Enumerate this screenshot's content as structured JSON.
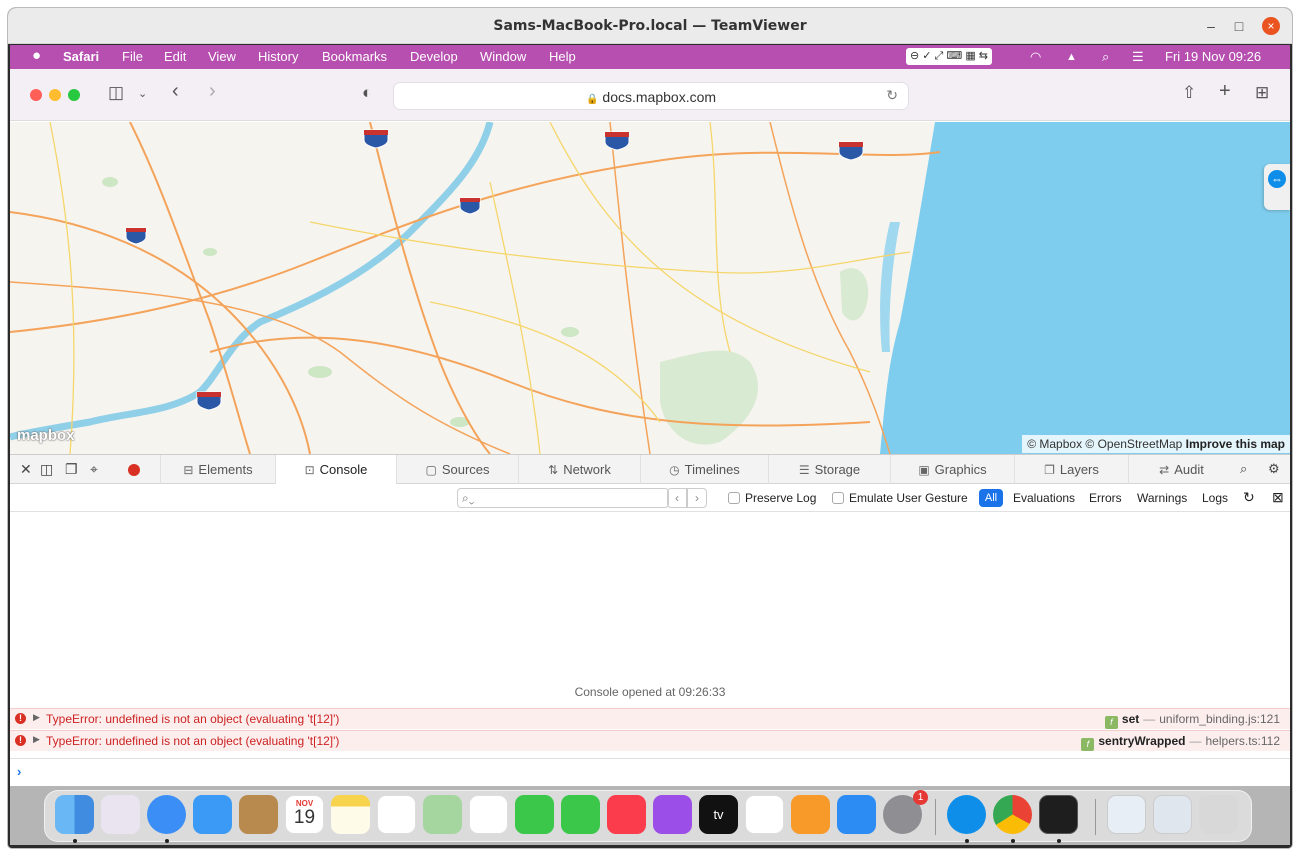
{
  "window": {
    "title": "Sams-MacBook-Pro.local — TeamViewer",
    "minimize": "–",
    "maximize": "□",
    "close": "×"
  },
  "menubar": {
    "app": "Safari",
    "items": [
      "File",
      "Edit",
      "View",
      "History",
      "Bookmarks",
      "Develop",
      "Window",
      "Help"
    ],
    "datetime": "Fri 19 Nov  09:26"
  },
  "browser": {
    "url": "docs.mapbox.com"
  },
  "map": {
    "logo": "mapbox",
    "attribution_1": "© Mapbox © OpenStreetMap",
    "attribution_link": "Improve this map",
    "water_color": "#7fcdee",
    "land_color": "#f6f4ef"
  },
  "devtools": {
    "tabs": [
      {
        "label": "Elements",
        "icon": "⊟"
      },
      {
        "label": "Console",
        "icon": "⊡"
      },
      {
        "label": "Sources",
        "icon": "▢"
      },
      {
        "label": "Network",
        "icon": "⇅"
      },
      {
        "label": "Timelines",
        "icon": "◷"
      },
      {
        "label": "Storage",
        "icon": "☰"
      },
      {
        "label": "Graphics",
        "icon": "▣"
      },
      {
        "label": "Layers",
        "icon": "❐"
      },
      {
        "label": "Audit",
        "icon": "⇄"
      }
    ],
    "active_tab": "Console",
    "filter": {
      "search_placeholder": "",
      "preserve_log": "Preserve Log",
      "emulate_user_gesture": "Emulate User Gesture",
      "all": "All",
      "evaluations": "Evaluations",
      "errors": "Errors",
      "warnings": "Warnings",
      "logs": "Logs"
    },
    "console_opened": "Console opened at 09:26:33",
    "errors": [
      {
        "message": "TypeError: undefined is not an object (evaluating 't[12]')",
        "function": "set",
        "file": "uniform_binding.js:121"
      },
      {
        "message": "TypeError: undefined is not an object (evaluating 't[12]')",
        "function": "sentryWrapped",
        "file": "helpers.ts:112"
      }
    ]
  },
  "dock": {
    "calendar_month": "NOV",
    "calendar_day": "19",
    "settings_badge": "1",
    "tv_label": "tv"
  }
}
